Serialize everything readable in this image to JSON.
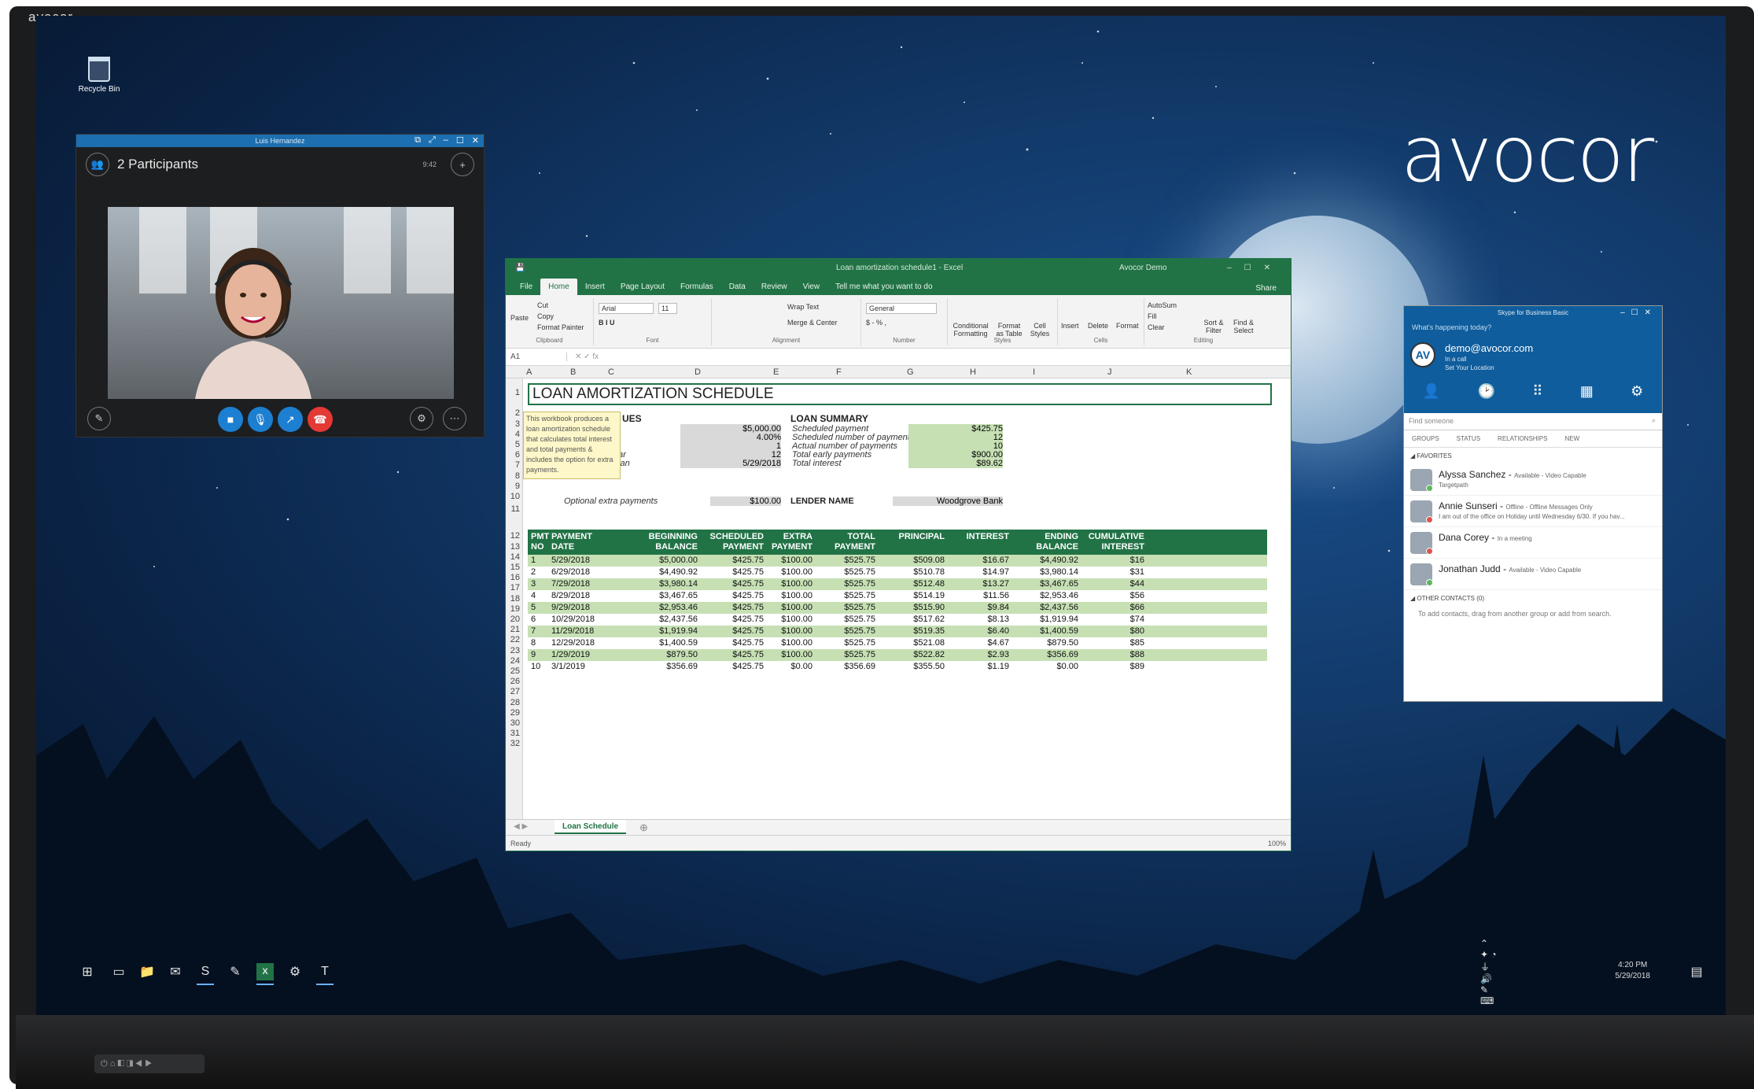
{
  "bezel": {
    "logo": "avocor"
  },
  "desktop": {
    "brand": "avocor",
    "recycle_bin": "Recycle Bin"
  },
  "call_window": {
    "title": "Luis Hernandez",
    "participants": "2 Participants",
    "signal": "9:42",
    "buttons": [
      "video-icon",
      "mic-icon",
      "share-icon",
      "hangup-icon"
    ],
    "colors": {
      "accent": "#1c7fd1",
      "hangup": "#e53935"
    }
  },
  "excel": {
    "title": "Loan amortization schedule1 - Excel",
    "user": "Avocor Demo",
    "tabs": [
      "File",
      "Home",
      "Insert",
      "Page Layout",
      "Formulas",
      "Data",
      "Review",
      "View"
    ],
    "tell_me": "Tell me what you want to do",
    "share": "Share",
    "ribbon": {
      "clipboard": {
        "paste": "Paste",
        "cut": "Cut",
        "copy": "Copy",
        "format_painter": "Format Painter",
        "label": "Clipboard"
      },
      "font": {
        "name": "Arial",
        "size": "11",
        "label": "Font"
      },
      "alignment": {
        "wrap": "Wrap Text",
        "merge": "Merge & Center",
        "label": "Alignment"
      },
      "number": {
        "format": "General",
        "label": "Number"
      },
      "styles": {
        "conditional": "Conditional Formatting",
        "format_table": "Format as Table",
        "cell_styles": "Cell Styles",
        "label": "Styles"
      },
      "cells": {
        "insert": "Insert",
        "delete": "Delete",
        "format": "Format",
        "label": "Cells"
      },
      "editing": {
        "autosum": "AutoSum",
        "fill": "Fill",
        "clear": "Clear",
        "sort": "Sort & Filter",
        "find": "Find & Select",
        "label": "Editing"
      }
    },
    "name_box": "A1",
    "columns": [
      "A",
      "B",
      "C",
      "D",
      "E",
      "F",
      "G",
      "H",
      "I",
      "J",
      "K"
    ],
    "rows": [
      "1",
      "2",
      "3",
      "4",
      "5",
      "6",
      "7",
      "8",
      "9",
      "10",
      "11",
      "12",
      "13",
      "14",
      "15",
      "16",
      "17",
      "18",
      "19",
      "20",
      "21",
      "22",
      "23",
      "24",
      "25",
      "26",
      "27",
      "28",
      "29",
      "30",
      "31",
      "32"
    ],
    "sheet_title": "LOAN AMORTIZATION SCHEDULE",
    "tooltip": "This workbook produces a loan amortization schedule that calculates total interest and total payments & includes the option for extra payments.",
    "values_header": "UES",
    "values": [
      {
        "label": "",
        "value": "$5,000.00"
      },
      {
        "label": "st rate",
        "value": "4.00%"
      },
      {
        "label": "n years",
        "value": "1"
      },
      {
        "label": "yments per year",
        "value": "12"
      },
      {
        "label": "Start date of loan",
        "value": "5/29/2018"
      }
    ],
    "extra_label": "Optional extra payments",
    "extra_value": "$100.00",
    "summary_header": "LOAN SUMMARY",
    "summary": [
      {
        "label": "Scheduled payment",
        "value": "$425.75"
      },
      {
        "label": "Scheduled number of payments",
        "value": "12"
      },
      {
        "label": "Actual number of payments",
        "value": "10"
      },
      {
        "label": "Total early payments",
        "value": "$900.00"
      },
      {
        "label": "Total interest",
        "value": "$89.62"
      }
    ],
    "lender_label": "LENDER NAME",
    "lender_value": "Woodgrove Bank",
    "table_headers": [
      "PMT NO",
      "PAYMENT DATE",
      "BEGINNING BALANCE",
      "SCHEDULED PAYMENT",
      "EXTRA PAYMENT",
      "TOTAL PAYMENT",
      "PRINCIPAL",
      "INTEREST",
      "ENDING BALANCE",
      "CUMULATIVE INTEREST"
    ],
    "table_rows": [
      [
        "1",
        "5/29/2018",
        "$5,000.00",
        "$425.75",
        "$100.00",
        "$525.75",
        "$509.08",
        "$16.67",
        "$4,490.92",
        "$16"
      ],
      [
        "2",
        "6/29/2018",
        "$4,490.92",
        "$425.75",
        "$100.00",
        "$525.75",
        "$510.78",
        "$14.97",
        "$3,980.14",
        "$31"
      ],
      [
        "3",
        "7/29/2018",
        "$3,980.14",
        "$425.75",
        "$100.00",
        "$525.75",
        "$512.48",
        "$13.27",
        "$3,467.65",
        "$44"
      ],
      [
        "4",
        "8/29/2018",
        "$3,467.65",
        "$425.75",
        "$100.00",
        "$525.75",
        "$514.19",
        "$11.56",
        "$2,953.46",
        "$56"
      ],
      [
        "5",
        "9/29/2018",
        "$2,953.46",
        "$425.75",
        "$100.00",
        "$525.75",
        "$515.90",
        "$9.84",
        "$2,437.56",
        "$66"
      ],
      [
        "6",
        "10/29/2018",
        "$2,437.56",
        "$425.75",
        "$100.00",
        "$525.75",
        "$517.62",
        "$8.13",
        "$1,919.94",
        "$74"
      ],
      [
        "7",
        "11/29/2018",
        "$1,919.94",
        "$425.75",
        "$100.00",
        "$525.75",
        "$519.35",
        "$6.40",
        "$1,400.59",
        "$80"
      ],
      [
        "8",
        "12/29/2018",
        "$1,400.59",
        "$425.75",
        "$100.00",
        "$525.75",
        "$521.08",
        "$4.67",
        "$879.50",
        "$85"
      ],
      [
        "9",
        "1/29/2019",
        "$879.50",
        "$425.75",
        "$100.00",
        "$525.75",
        "$522.82",
        "$2.93",
        "$356.69",
        "$88"
      ],
      [
        "10",
        "3/1/2019",
        "$356.69",
        "$425.75",
        "$0.00",
        "$356.69",
        "$355.50",
        "$1.19",
        "$0.00",
        "$89"
      ]
    ],
    "sheet_tab": "Loan Schedule",
    "status": "Ready",
    "zoom": "100%",
    "colors": {
      "accent": "#217346",
      "band": "#c6e0b4"
    }
  },
  "skype": {
    "title": "Skype for Business Basic",
    "prompt": "What's happening today?",
    "avatar": "AV",
    "email": "demo@avocor.com",
    "status": "In a call",
    "location": "Set Your Location",
    "search": "Find someone",
    "tabs": [
      "GROUPS",
      "STATUS",
      "RELATIONSHIPS",
      "NEW"
    ],
    "favorites": "FAVORITES",
    "contacts": [
      {
        "name": "Alyssa Sanchez",
        "status": "Available - Video Capable",
        "note": "Targetpath",
        "color": "#5cb85c"
      },
      {
        "name": "Annie Sunseri",
        "status": "Offline - Offline Messages Only",
        "note": "I am out of the office on Holiday until Wednesday 6/30. If you hav...",
        "color": "#d9534f"
      },
      {
        "name": "Dana Corey",
        "status": "In a meeting",
        "note": "",
        "color": "#d9534f"
      },
      {
        "name": "Jonathan Judd",
        "status": "Available - Video Capable",
        "note": "",
        "color": "#5cb85c"
      }
    ],
    "other_contacts": "OTHER CONTACTS (0)",
    "other_hint": "To add contacts, drag from another group or add from search."
  },
  "taskbar": {
    "time": "4:20 PM",
    "date": "5/29/2018"
  }
}
